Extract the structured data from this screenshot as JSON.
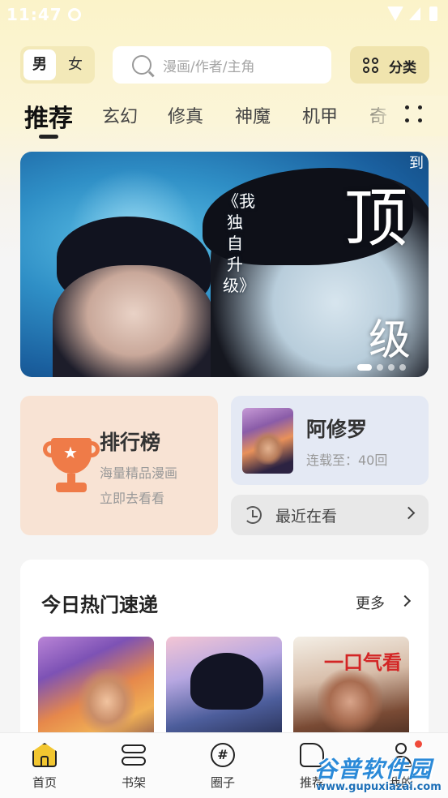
{
  "status_bar": {
    "time": "11:47"
  },
  "header": {
    "gender": {
      "male": "男",
      "female": "女",
      "selected": "男"
    },
    "search": {
      "placeholder": "漫画/作者/主角"
    },
    "category_label": "分类"
  },
  "tabs": {
    "active": "推荐",
    "items": [
      "推荐",
      "玄幻",
      "修真",
      "神魔",
      "机甲",
      "奇"
    ]
  },
  "banner": {
    "vertical_title": "《我独自升级》",
    "big_text_1": "顶",
    "big_text_2": "级",
    "corner_text": "到",
    "page_count": 5,
    "active_index": 0
  },
  "ranking": {
    "title": "排行榜",
    "subtitle_1": "海量精品漫画",
    "subtitle_2": "立即去看看",
    "icon": "trophy-icon",
    "accent": "#ef7b48"
  },
  "continue_reading": {
    "title": "阿修罗",
    "status": "连载至：40回"
  },
  "recent": {
    "label": "最近在看"
  },
  "hot_today": {
    "title": "今日热门速递",
    "more_label": "更多",
    "covers": [
      {
        "text": ""
      },
      {
        "text": ""
      },
      {
        "text": "一口气看"
      }
    ]
  },
  "bottom_nav": {
    "items": [
      {
        "label": "首页",
        "icon": "home-icon",
        "active": true
      },
      {
        "label": "书架",
        "icon": "bookshelf-icon",
        "active": false
      },
      {
        "label": "圈子",
        "icon": "circle-hash-icon",
        "active": false
      },
      {
        "label": "推荐",
        "icon": "recommend-icon",
        "active": false
      },
      {
        "label": "我的",
        "icon": "profile-icon",
        "active": false
      }
    ],
    "badge_color": "#f04a3a"
  },
  "watermark": {
    "main": "谷普软件园",
    "url": "www.gupuxiazai.com"
  }
}
